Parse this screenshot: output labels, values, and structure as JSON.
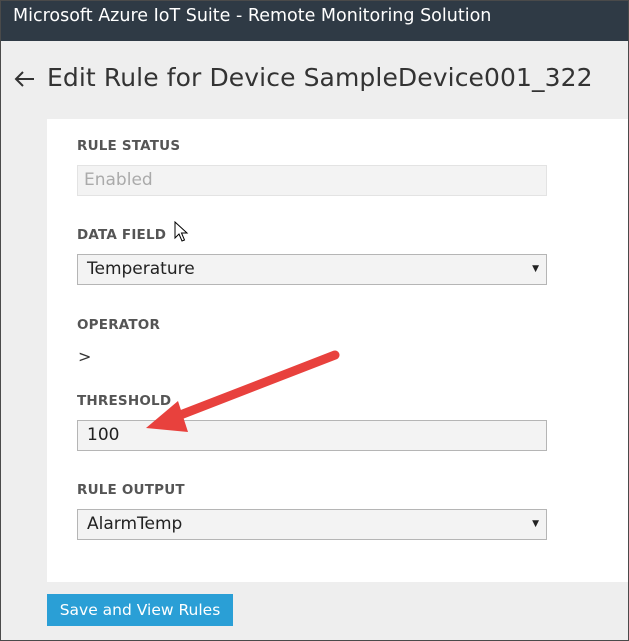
{
  "window": {
    "title": "Microsoft Azure IoT Suite - Remote Monitoring Solution"
  },
  "header": {
    "title": "Edit Rule for Device SampleDevice001_322"
  },
  "form": {
    "rule_status": {
      "label": "RULE STATUS",
      "value": "Enabled"
    },
    "data_field": {
      "label": "DATA FIELD",
      "value": "Temperature"
    },
    "operator": {
      "label": "OPERATOR",
      "value": ">"
    },
    "threshold": {
      "label": "THRESHOLD",
      "value": "100"
    },
    "rule_output": {
      "label": "RULE OUTPUT",
      "value": "AlarmTemp"
    }
  },
  "actions": {
    "save_label": "Save and View Rules"
  },
  "colors": {
    "titlebar": "#2f3a45",
    "primary_button": "#2a9fd6",
    "annotation_arrow": "#e8413d"
  },
  "icons": {
    "back": "arrow-left-icon",
    "dropdown": "caret-down-icon",
    "annotation": "red-arrow-icon",
    "cursor": "mouse-pointer-icon"
  }
}
